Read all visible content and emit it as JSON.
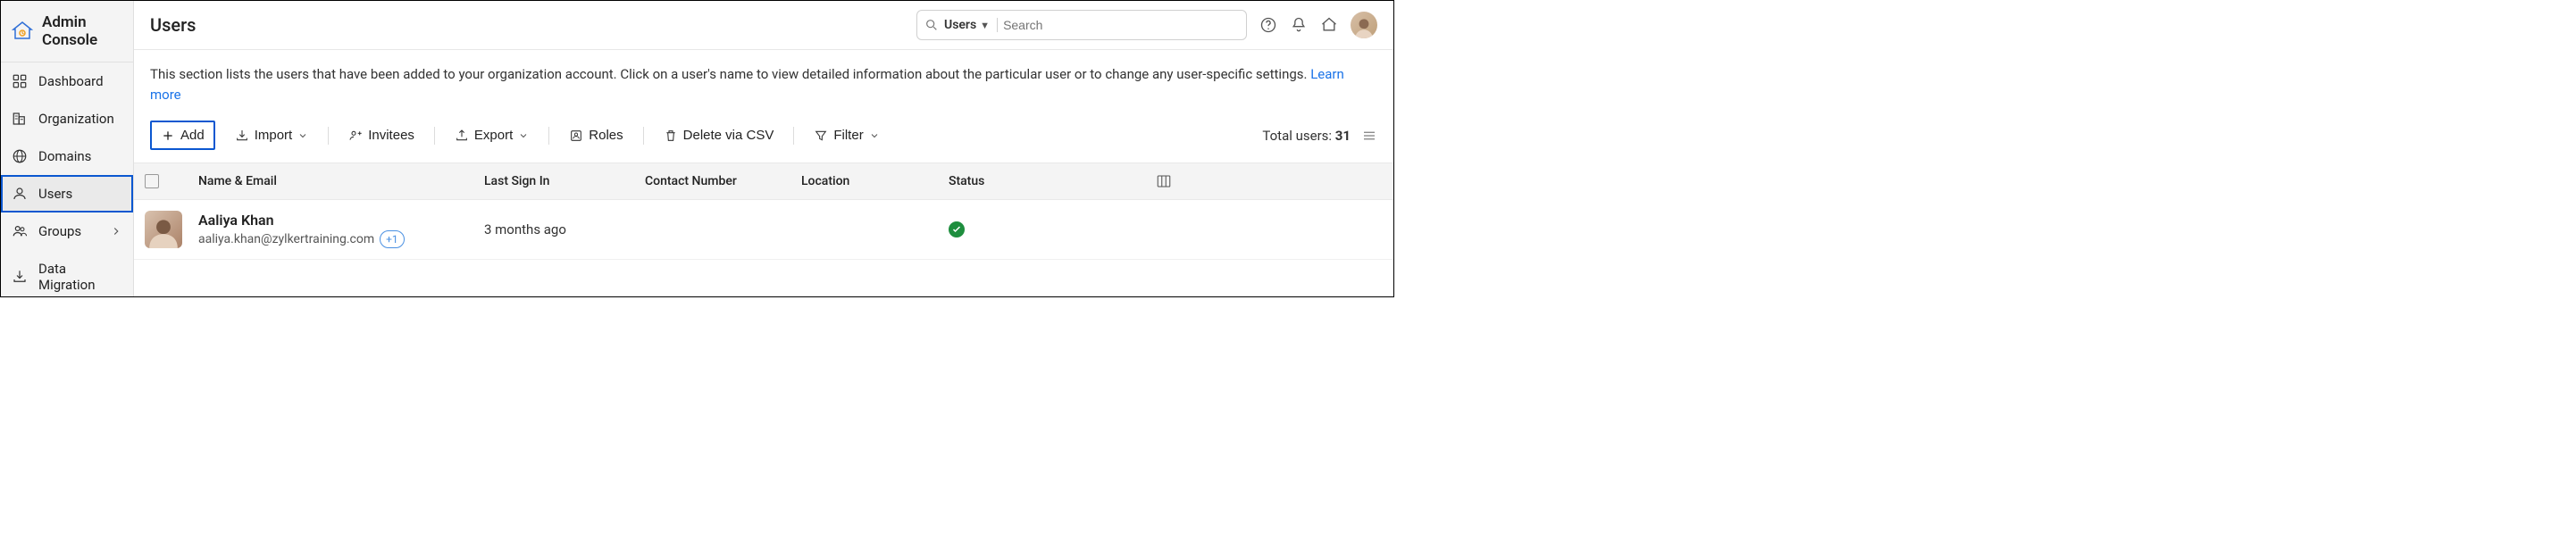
{
  "app_title": "Admin Console",
  "sidebar": {
    "items": [
      {
        "label": "Dashboard",
        "icon": "dashboard-icon"
      },
      {
        "label": "Organization",
        "icon": "organization-icon"
      },
      {
        "label": "Domains",
        "icon": "globe-icon"
      },
      {
        "label": "Users",
        "icon": "user-icon",
        "active": true
      },
      {
        "label": "Groups",
        "icon": "group-icon",
        "has_submenu": true
      },
      {
        "label": "Data Migration",
        "icon": "migration-icon"
      }
    ]
  },
  "header": {
    "page_title": "Users",
    "search": {
      "scope_selected": "Users",
      "placeholder": "Search"
    }
  },
  "description": {
    "text": "This section lists the users that have been added to your organization account. Click on a user's name to view detailed information about the particular user or to change any user-specific settings.  ",
    "learn_more": "Learn more"
  },
  "toolbar": {
    "add": "Add",
    "import": "Import",
    "invitees": "Invitees",
    "export": "Export",
    "roles": "Roles",
    "delete_csv": "Delete via CSV",
    "filter": "Filter",
    "total_label": "Total users:",
    "total_count": "31"
  },
  "table": {
    "columns": {
      "name_email": "Name & Email",
      "last_signin": "Last Sign In",
      "contact": "Contact Number",
      "location": "Location",
      "status": "Status"
    },
    "rows": [
      {
        "name": "Aaliya Khan",
        "email": "aaliya.khan@zylkertraining.com",
        "extra_badge": "+1",
        "last_signin": "3 months ago",
        "contact": "",
        "location": "",
        "status": "active"
      }
    ]
  }
}
